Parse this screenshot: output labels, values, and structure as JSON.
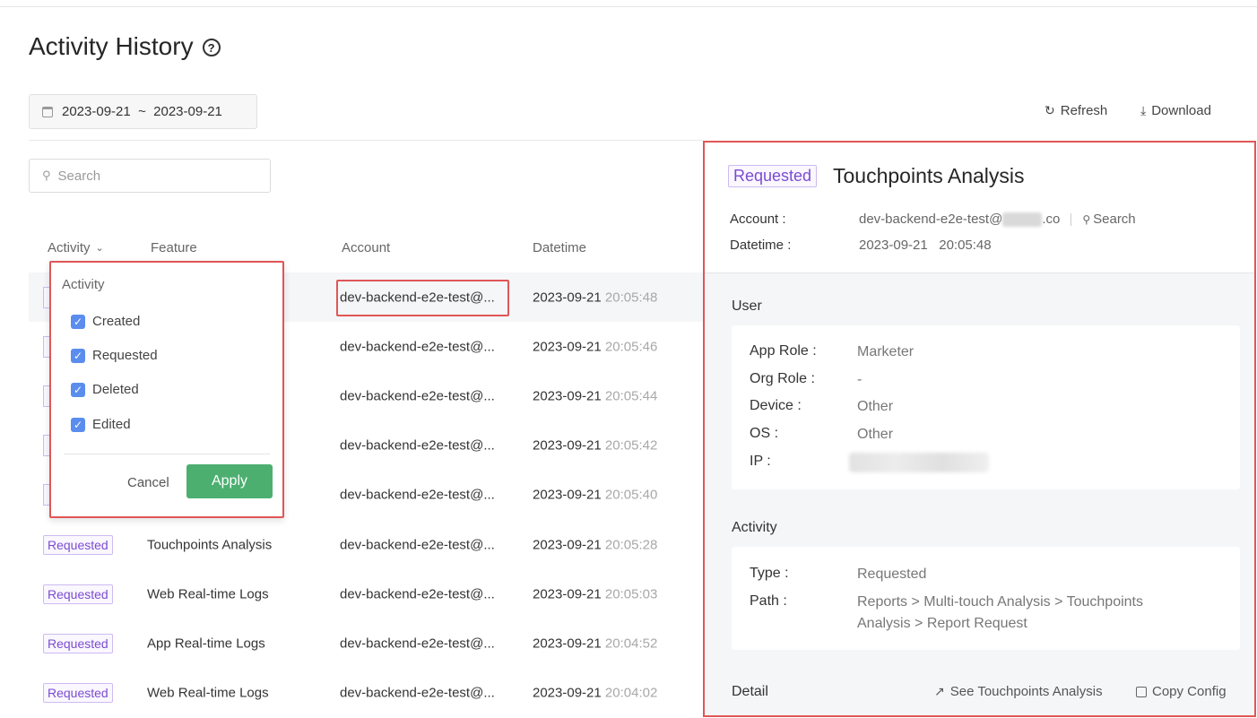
{
  "page": {
    "title": "Activity History",
    "date_range": "2023-09-21  ~  2023-09-21",
    "refresh_label": "Refresh",
    "download_label": "Download",
    "search_placeholder": "Search"
  },
  "table": {
    "columns": {
      "activity": "Activity",
      "feature": "Feature",
      "account": "Account",
      "datetime": "Datetime"
    },
    "rows": [
      {
        "activity": "",
        "feature": "",
        "account": "dev-backend-e2e-test@...",
        "date": "2023-09-21",
        "time": "20:05:48"
      },
      {
        "activity": "",
        "feature": "",
        "account": "dev-backend-e2e-test@...",
        "date": "2023-09-21",
        "time": "20:05:46"
      },
      {
        "activity": "",
        "feature": "",
        "account": "dev-backend-e2e-test@...",
        "date": "2023-09-21",
        "time": "20:05:44"
      },
      {
        "activity": "",
        "feature": "",
        "account": "dev-backend-e2e-test@...",
        "date": "2023-09-21",
        "time": "20:05:42"
      },
      {
        "activity": "",
        "feature": "",
        "account": "dev-backend-e2e-test@...",
        "date": "2023-09-21",
        "time": "20:05:40"
      },
      {
        "activity": "Requested",
        "feature": "Touchpoints Analysis",
        "account": "dev-backend-e2e-test@...",
        "date": "2023-09-21",
        "time": "20:05:28"
      },
      {
        "activity": "Requested",
        "feature": "Web Real-time Logs",
        "account": "dev-backend-e2e-test@...",
        "date": "2023-09-21",
        "time": "20:05:03"
      },
      {
        "activity": "Requested",
        "feature": "App Real-time Logs",
        "account": "dev-backend-e2e-test@...",
        "date": "2023-09-21",
        "time": "20:04:52"
      },
      {
        "activity": "Requested",
        "feature": "Web Real-time Logs",
        "account": "dev-backend-e2e-test@...",
        "date": "2023-09-21",
        "time": "20:04:02"
      }
    ]
  },
  "filter": {
    "title": "Activity",
    "options": [
      "Created",
      "Requested",
      "Deleted",
      "Edited"
    ],
    "cancel_label": "Cancel",
    "apply_label": "Apply"
  },
  "detail": {
    "badge": "Requested",
    "title": "Touchpoints Analysis",
    "account_label": "Account :",
    "account_prefix": "dev-backend-e2e-test@",
    "account_suffix": ".co",
    "search_label": "Search",
    "datetime_label": "Datetime :",
    "datetime_value": "2023-09-21   20:05:48",
    "user_section": "User",
    "user": {
      "app_role_label": "App Role :",
      "app_role": "Marketer",
      "org_role_label": "Org Role :",
      "org_role": "-",
      "device_label": "Device :",
      "device": "Other",
      "os_label": "OS :",
      "os": "Other",
      "ip_label": "IP :"
    },
    "activity_section": "Activity",
    "activity": {
      "type_label": "Type :",
      "type": "Requested",
      "path_label": "Path :",
      "path": "Reports > Multi-touch Analysis > Touchpoints Analysis > Report Request"
    },
    "detail_section": "Detail",
    "see_link": "See Touchpoints Analysis",
    "copy_link": "Copy Config"
  },
  "colors": {
    "badge": "#7b4cd1",
    "apply": "#4caf70",
    "highlight": "#e05656",
    "checkbox": "#5b8def"
  }
}
